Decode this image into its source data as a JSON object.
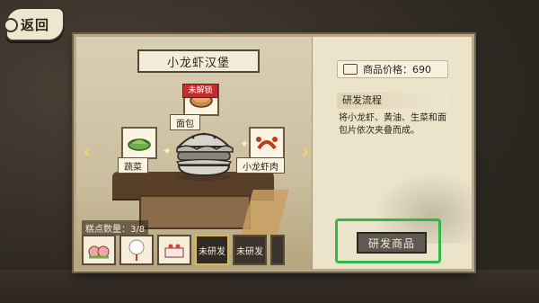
{
  "nav": {
    "back_label": "返回"
  },
  "recipe": {
    "title": "小龙虾汉堡",
    "locked_badge": "未解锁",
    "ingredients": {
      "top": "面包",
      "left": "蔬菜",
      "right": "小龙虾肉"
    },
    "tray_label": "糕点数量：3/8",
    "tray_items": [
      {
        "label": "",
        "icon": "peach-bun-icon"
      },
      {
        "label": "",
        "icon": "cotton-candy-icon"
      },
      {
        "label": "",
        "icon": "strawberry-cake-icon"
      },
      {
        "label": "未研发",
        "icon": "locked-dish-icon"
      },
      {
        "label": "未研发",
        "icon": "locked-dish-icon"
      }
    ]
  },
  "details": {
    "price_label": "商品价格：690",
    "process_title": "研发流程",
    "process_text": "将小龙虾、黄油、生菜和面包片依次夹叠而成。",
    "develop_button": "研发商品"
  },
  "colors": {
    "highlight": "#2fb84a",
    "arrow": "#f2d36b",
    "lock_red": "#c22f2f"
  }
}
